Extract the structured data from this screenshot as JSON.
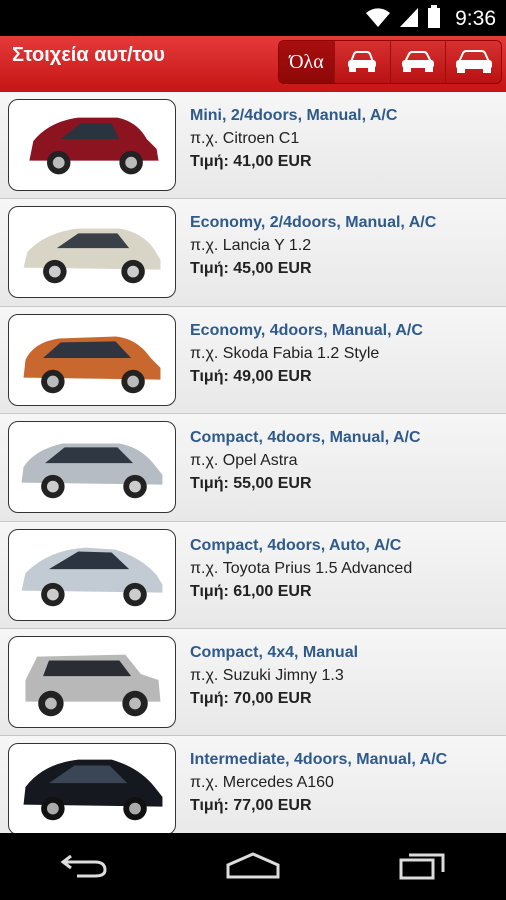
{
  "status": {
    "time": "9:36"
  },
  "app_bar": {
    "title": "Στοιχεία αυτ/του",
    "filters": [
      {
        "label": "Όλα",
        "icon": "all-text"
      },
      {
        "label": "",
        "icon": "small-car-icon"
      },
      {
        "label": "",
        "icon": "medium-car-icon"
      },
      {
        "label": "",
        "icon": "large-car-icon"
      }
    ]
  },
  "cars": [
    {
      "title": "Mini, 2/4doors, Manual, A/C",
      "model": "π.χ. Citroen C1",
      "price": "Τιμή: 41,00 EUR",
      "color": "#8b1420"
    },
    {
      "title": "Economy, 2/4doors, Manual, A/C",
      "model": "π.χ. Lancia Y 1.2",
      "price": "Τιμή: 45,00 EUR",
      "color": "#d8d4c6"
    },
    {
      "title": "Economy, 4doors, Manual, A/C",
      "model": "π.χ. Skoda Fabia 1.2 Style",
      "price": "Τιμή: 49,00 EUR",
      "color": "#c8682e"
    },
    {
      "title": "Compact, 4doors, Manual, A/C",
      "model": "π.χ. Opel Astra",
      "price": "Τιμή: 55,00 EUR",
      "color": "#b6bcc4"
    },
    {
      "title": "Compact, 4doors, Auto, A/C",
      "model": "π.χ. Toyota Prius 1.5 Advanced",
      "price": "Τιμή: 61,00 EUR",
      "color": "#c2cad4"
    },
    {
      "title": "Compact, 4x4, Manual",
      "model": "π.χ. Suzuki Jimny 1.3",
      "price": "Τιμή: 70,00 EUR",
      "color": "#b8b8b8"
    },
    {
      "title": "Intermediate, 4doors, Manual, A/C",
      "model": "π.χ. Mercedes A160",
      "price": "Τιμή: 77,00 EUR",
      "color": "#15181e"
    }
  ],
  "colors": {
    "app_bar": "#d42424",
    "title_blue": "#2e5a8c"
  }
}
